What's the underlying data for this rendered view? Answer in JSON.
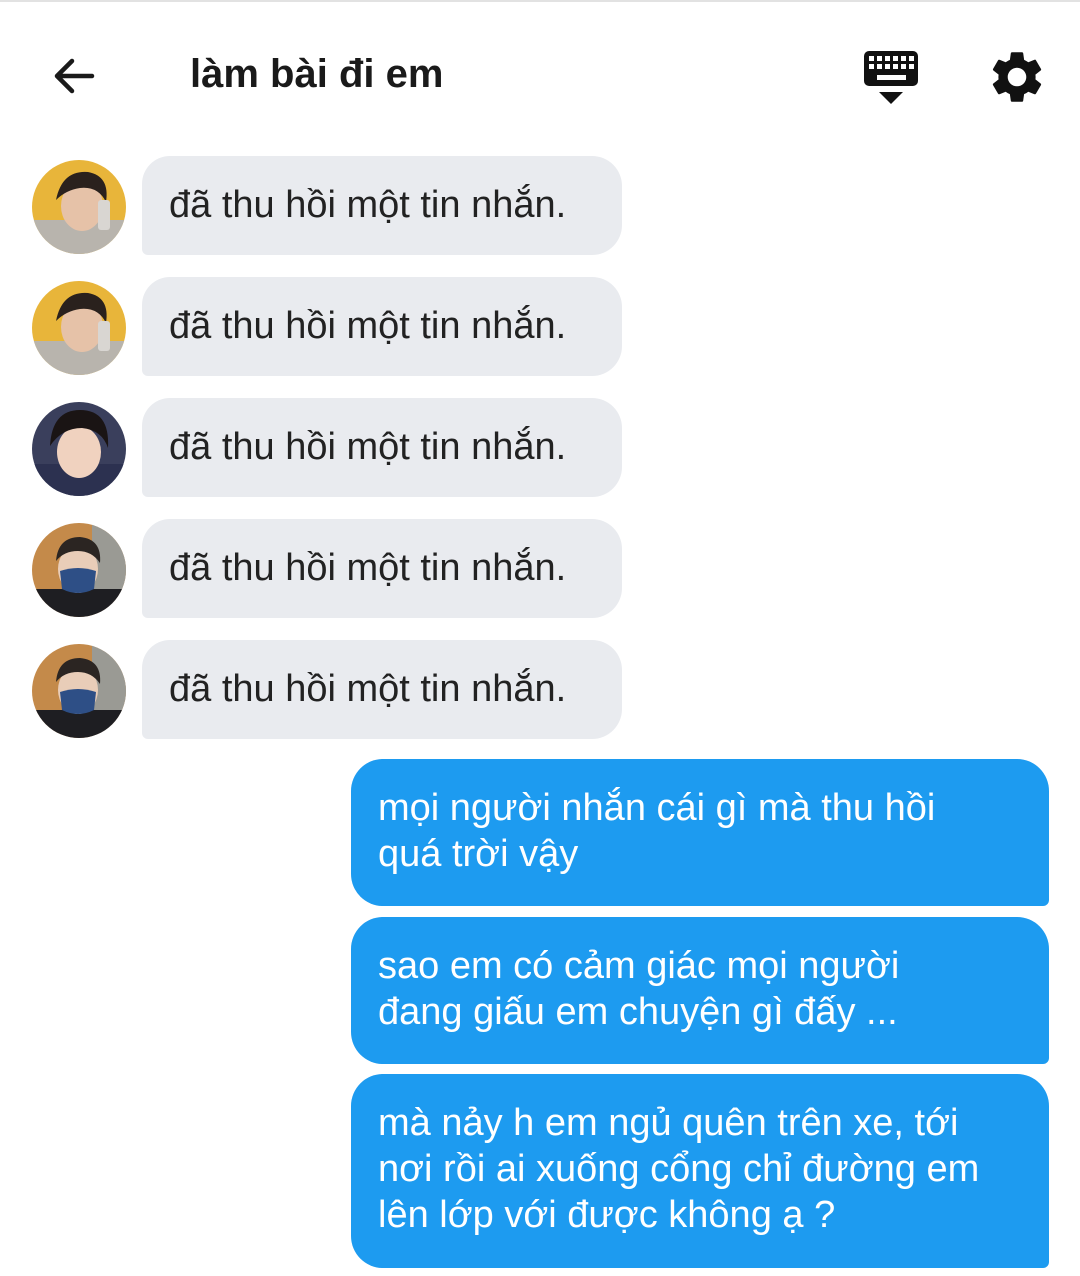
{
  "header": {
    "title": "làm bài đi em",
    "back_icon": "arrow-left-icon",
    "keyboard_icon": "keyboard-hide-icon",
    "settings_icon": "gear-icon"
  },
  "colors": {
    "incoming_bubble": "#e9ebef",
    "outgoing_bubble": "#1d9bf0",
    "text": "#1c1c1c"
  },
  "messages": {
    "incoming": [
      {
        "text": "đã thu hồi một tin nhắn."
      },
      {
        "text": "đã thu hồi một tin nhắn."
      },
      {
        "text": "đã thu hồi một tin nhắn."
      },
      {
        "text": "đã thu hồi một tin nhắn."
      },
      {
        "text": "đã thu hồi một tin nhắn."
      }
    ],
    "outgoing": [
      {
        "line1": "mọi người nhắn cái gì mà thu hồi",
        "line2": "quá trời vậy"
      },
      {
        "line1": "sao em có cảm giác mọi người",
        "line2": "đang giấu em chuyện gì đấy ..."
      },
      {
        "line1": "mà nảy h em ngủ quên trên xe, tới",
        "line2": "nơi rồi ai xuống cổng chỉ đường em",
        "line3": "lên lớp với được không ạ ?"
      }
    ]
  }
}
